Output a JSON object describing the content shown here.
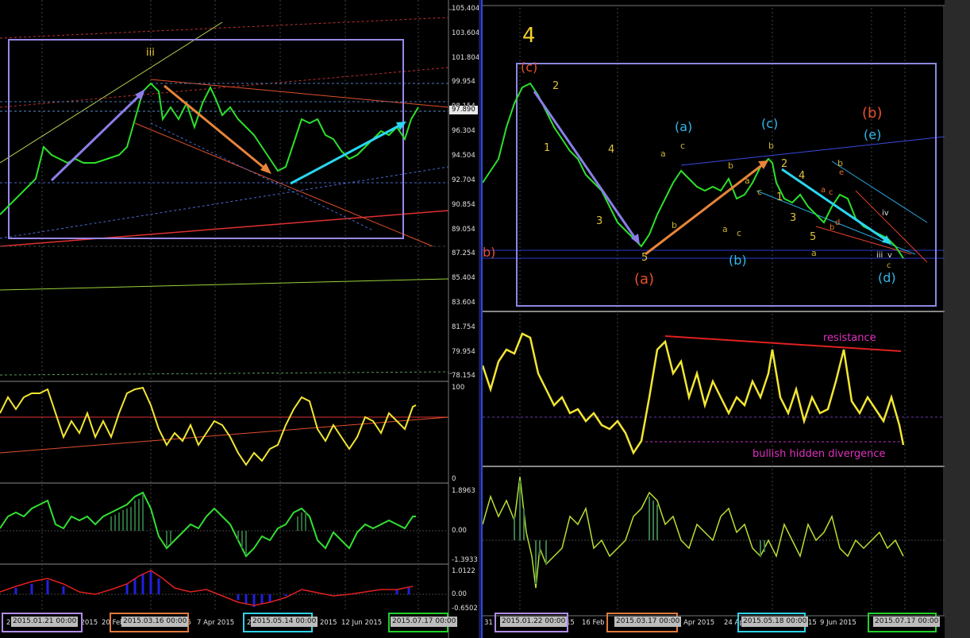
{
  "left_chart": {
    "price_labels": [
      "105.404",
      "103.604",
      "101.804",
      "99.954",
      "98.154",
      "96.304",
      "94.504",
      "92.704",
      "90.854",
      "89.054",
      "87.254",
      "85.404",
      "83.604",
      "81.754",
      "79.954",
      "78.154"
    ],
    "current_price": "97.890",
    "wave_label": "iii",
    "osc1_labels": [
      "100",
      "0"
    ],
    "osc2_labels": [
      "1.8963",
      "0.00",
      "-1.3933"
    ],
    "osc3_labels": [
      "1.0122",
      "0.00",
      "-0.6502"
    ],
    "date_labels": [
      "2",
      "un 2015",
      "20 Feb",
      "15",
      "7 Apr 2015",
      "21",
      "ay 2015",
      "12 Jun 2015"
    ],
    "markers": [
      "2015.01.21 00:00",
      "2015.03.16 00:00",
      "2015.05.14 00:00",
      "2015.07.17 00:00"
    ]
  },
  "right_chart": {
    "wave_labels": {
      "big4": "4",
      "c_top": "(c)",
      "b_left": "b)",
      "n2a": "2",
      "n1a": "1",
      "n4a": "4",
      "n3a": "3",
      "n5a": "5",
      "a_paren": "(a)",
      "a_blue": "(a)",
      "b_blue": "(b)",
      "c_blue": "(c)",
      "b_red": "(b)",
      "e_blue": "(e)",
      "d_blue": "(d)",
      "sm_a": "a",
      "sm_c": "c",
      "sm_b": "b",
      "sm_b2": "b",
      "sm_a2": "a",
      "sm_c2": "c",
      "sm_a3": "a",
      "sm_c3": "c",
      "sm_b3": "b",
      "n2b": "2",
      "n1b": "1",
      "n4b": "4",
      "n3b": "3",
      "n5b": "5",
      "sm_a4": "a",
      "sm_b4": "b",
      "sm_e": "e",
      "sm_a5": "a",
      "sm_c5": "c",
      "sm_b5": "b",
      "sm_d": "d",
      "iv": "iv",
      "iii": "iii",
      "v": "v",
      "sm_c6": "c"
    },
    "resistance_label": "resistance",
    "divergence_label": "bullish hidden divergence",
    "date_labels": [
      "31",
      "15",
      "16 Feb",
      "1 Apr 2015",
      "24 Ap",
      "15",
      "9 Jun 2015"
    ],
    "markers": [
      "2015.01.22 00:00",
      "2015.03.17 00:00",
      "2015.05.18 00:00",
      "2015.07.17 00:00"
    ]
  },
  "colors": {
    "marker1": "#b08ce8",
    "marker2": "#e07a3a",
    "marker3": "#2fd2e6",
    "marker4": "#22d02a",
    "purple_arrow": "#8a7ee8",
    "orange_arrow": "#e8843a",
    "cyan_arrow": "#2ad6f0"
  }
}
